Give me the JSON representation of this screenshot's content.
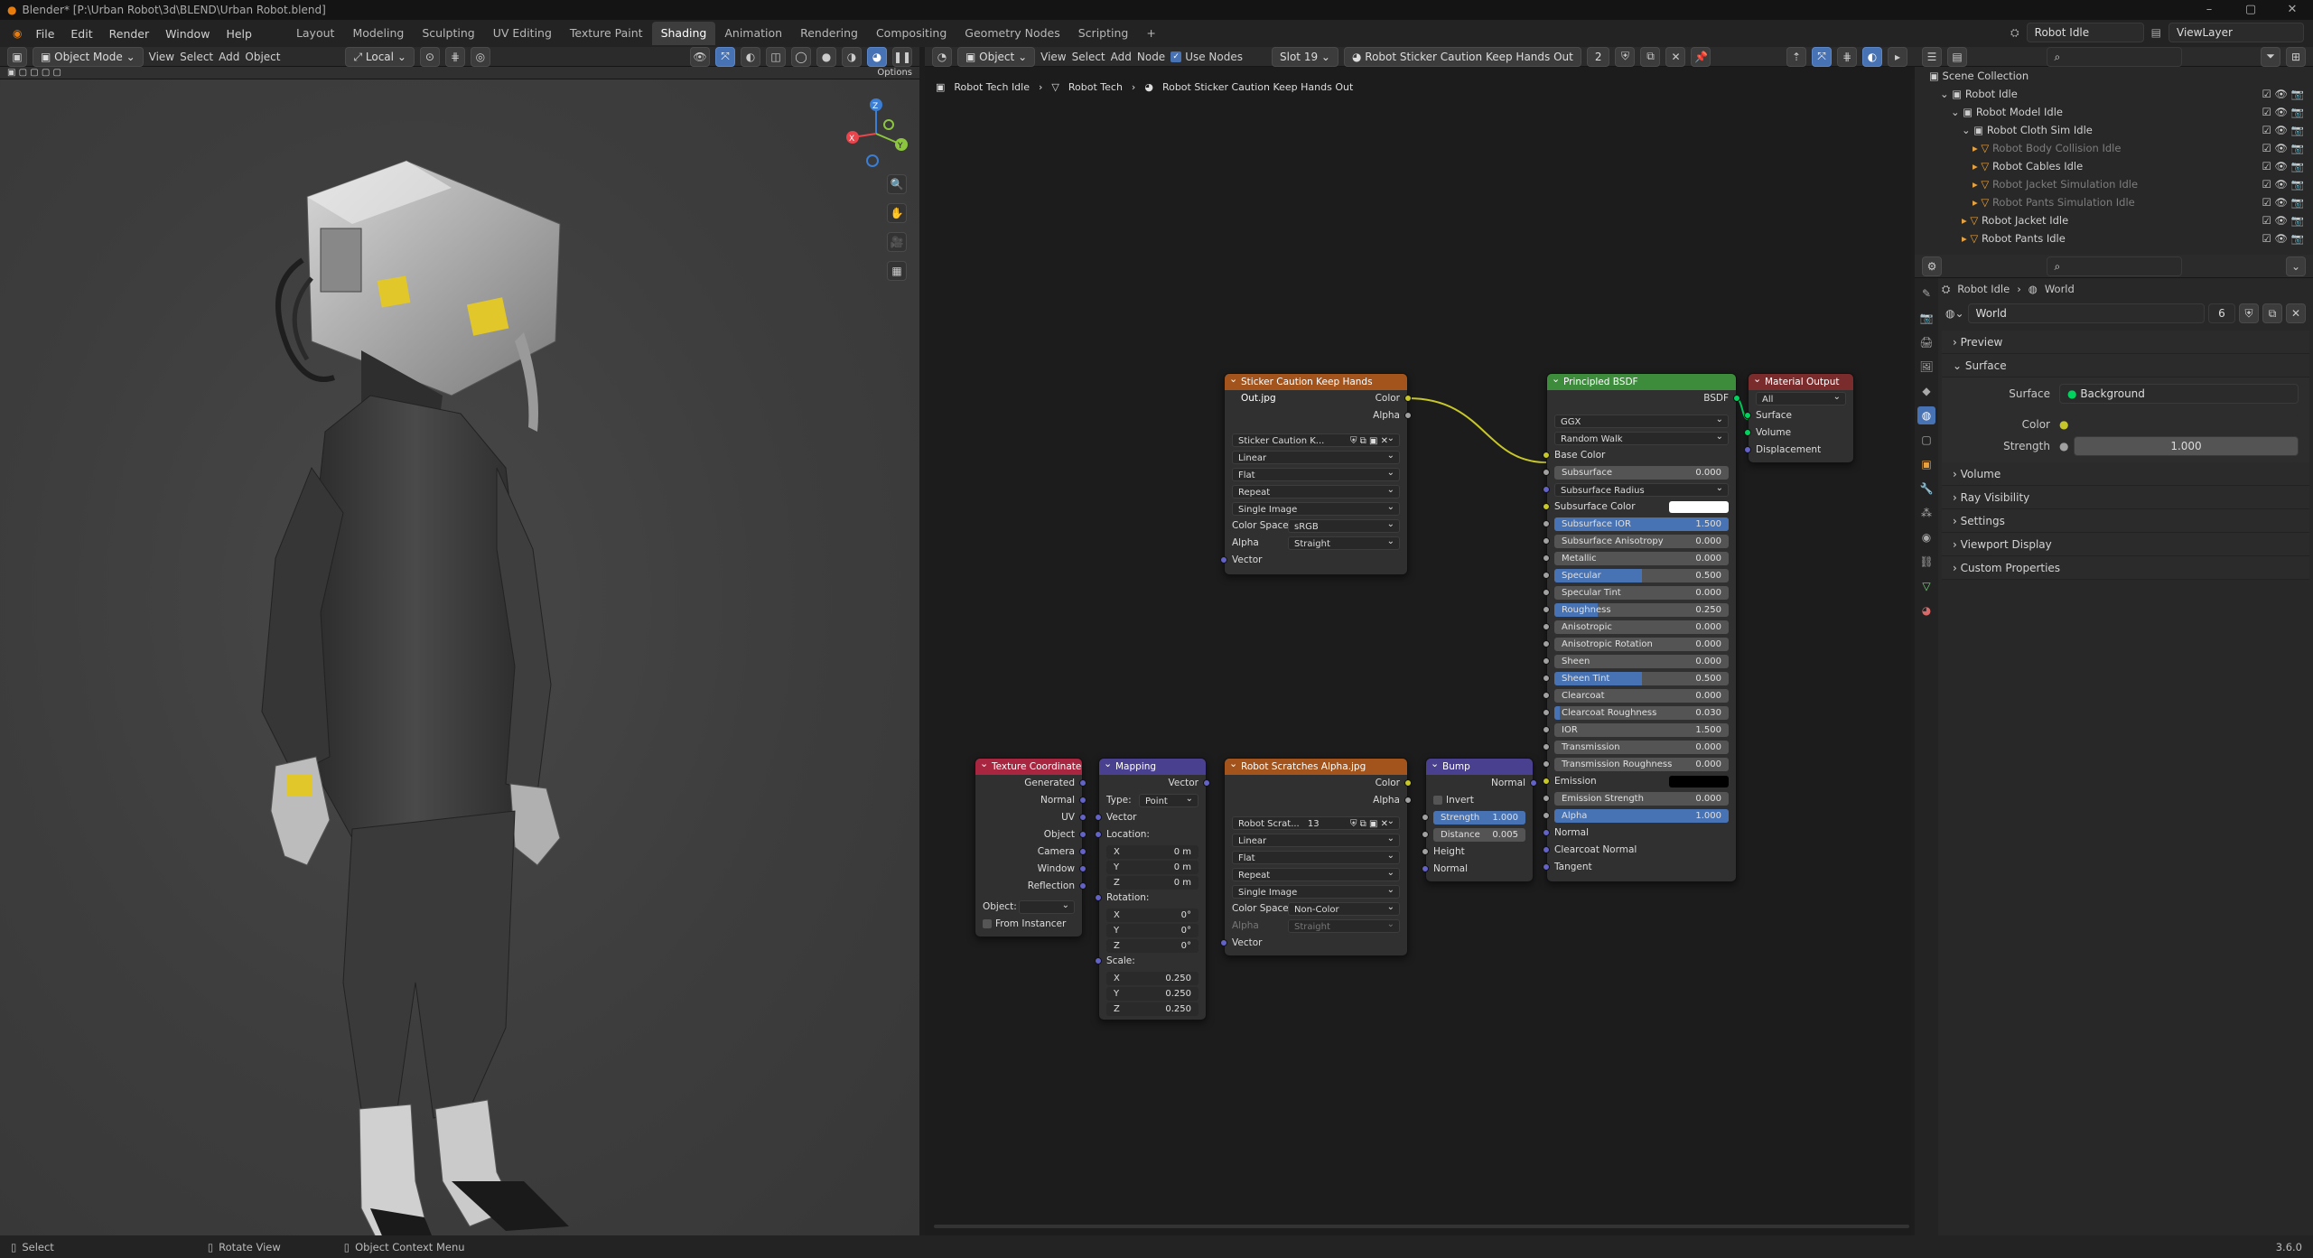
{
  "window": {
    "title": "Blender* [P:\\Urban Robot\\3d\\BLEND\\Urban Robot.blend]",
    "controls": [
      "–",
      "▢",
      "✕"
    ]
  },
  "menus": [
    "File",
    "Edit",
    "Render",
    "Window",
    "Help"
  ],
  "workspaces": [
    "Layout",
    "Modeling",
    "Sculpting",
    "UV Editing",
    "Texture Paint",
    "Shading",
    "Animation",
    "Rendering",
    "Compositing",
    "Geometry Nodes",
    "Scripting"
  ],
  "active_workspace": "Shading",
  "scene_name": "Robot Idle",
  "view_layer": "ViewLayer",
  "viewport": {
    "mode": "Object Mode",
    "menus": [
      "View",
      "Select",
      "Add",
      "Object"
    ],
    "transform_orientation": "Local",
    "options_label": "Options"
  },
  "node_editor": {
    "object_type": "Object",
    "menus": [
      "View",
      "Select",
      "Add",
      "Node"
    ],
    "use_nodes_label": "Use Nodes",
    "slot": "Slot 19",
    "material": "Robot Sticker Caution Keep Hands Out",
    "users": "2",
    "breadcrumb": [
      "Robot Tech Idle",
      "Robot Tech",
      "Robot Sticker Caution Keep Hands Out"
    ]
  },
  "nodes": {
    "sticker_image": {
      "title": "Sticker Caution Keep Hands Out.jpg",
      "outputs": [
        "Color",
        "Alpha"
      ],
      "image_name": "Sticker Caution K...",
      "interpolation": "Linear",
      "projection": "Flat",
      "extension": "Repeat",
      "source": "Single Image",
      "color_space_label": "Color Space",
      "color_space": "sRGB",
      "alpha_label": "Alpha",
      "alpha": "Straight",
      "input": "Vector"
    },
    "bsdf": {
      "title": "Principled BSDF",
      "output": "BSDF",
      "distribution": "GGX",
      "subsurface_method": "Random Walk",
      "base_color": "Base Color",
      "rows": [
        {
          "label": "Subsurface",
          "value": "0.000",
          "fill": 0
        },
        {
          "label": "Subsurface Radius",
          "value": "",
          "fill": 0,
          "dropdown": true
        },
        {
          "label": "Subsurface Color",
          "value": "",
          "fill": 0,
          "color": "#ffffff"
        },
        {
          "label": "Subsurface IOR",
          "value": "1.500",
          "fill": 1
        },
        {
          "label": "Subsurface Anisotropy",
          "value": "0.000",
          "fill": 0
        },
        {
          "label": "Metallic",
          "value": "0.000",
          "fill": 0
        },
        {
          "label": "Specular",
          "value": "0.500",
          "fill": 0.5
        },
        {
          "label": "Specular Tint",
          "value": "0.000",
          "fill": 0
        },
        {
          "label": "Roughness",
          "value": "0.250",
          "fill": 0.25
        },
        {
          "label": "Anisotropic",
          "value": "0.000",
          "fill": 0
        },
        {
          "label": "Anisotropic Rotation",
          "value": "0.000",
          "fill": 0
        },
        {
          "label": "Sheen",
          "value": "0.000",
          "fill": 0
        },
        {
          "label": "Sheen Tint",
          "value": "0.500",
          "fill": 0.5
        },
        {
          "label": "Clearcoat",
          "value": "0.000",
          "fill": 0
        },
        {
          "label": "Clearcoat Roughness",
          "value": "0.030",
          "fill": 0.03
        },
        {
          "label": "IOR",
          "value": "1.500",
          "fill": 0
        },
        {
          "label": "Transmission",
          "value": "0.000",
          "fill": 0
        },
        {
          "label": "Transmission Roughness",
          "value": "0.000",
          "fill": 0
        },
        {
          "label": "Emission",
          "value": "",
          "fill": 0,
          "color": "#000000"
        },
        {
          "label": "Emission Strength",
          "value": "0.000",
          "fill": 0
        },
        {
          "label": "Alpha",
          "value": "1.000",
          "fill": 1
        }
      ],
      "tail_inputs": [
        "Normal",
        "Clearcoat Normal",
        "Tangent"
      ]
    },
    "material_output": {
      "title": "Material Output",
      "target": "All",
      "inputs": [
        "Surface",
        "Volume",
        "Displacement"
      ]
    },
    "tex_coord": {
      "title": "Texture Coordinate",
      "outputs": [
        "Generated",
        "Normal",
        "UV",
        "Object",
        "Camera",
        "Window",
        "Reflection"
      ],
      "object_label": "Object:",
      "from_instancer": "From Instancer"
    },
    "mapping": {
      "title": "Mapping",
      "output": "Vector",
      "type_label": "Type:",
      "type": "Point",
      "vector": "Vector",
      "location_label": "Location:",
      "rotation_label": "Rotation:",
      "scale_label": "Scale:",
      "location": [
        {
          "axis": "X",
          "value": "0 m"
        },
        {
          "axis": "Y",
          "value": "0 m"
        },
        {
          "axis": "Z",
          "value": "0 m"
        }
      ],
      "rotation": [
        {
          "axis": "X",
          "value": "0°"
        },
        {
          "axis": "Y",
          "value": "0°"
        },
        {
          "axis": "Z",
          "value": "0°"
        }
      ],
      "scale": [
        {
          "axis": "X",
          "value": "0.250"
        },
        {
          "axis": "Y",
          "value": "0.250"
        },
        {
          "axis": "Z",
          "value": "0.250"
        }
      ]
    },
    "scratch_image": {
      "title": "Robot Scratches Alpha.jpg",
      "outputs": [
        "Color",
        "Alpha"
      ],
      "image_name": "Robot Scrat...",
      "users": "13",
      "interpolation": "Linear",
      "projection": "Flat",
      "extension": "Repeat",
      "source": "Single Image",
      "color_space_label": "Color Space",
      "color_space": "Non-Color",
      "alpha_label": "Alpha",
      "alpha": "Straight",
      "input": "Vector"
    },
    "bump": {
      "title": "Bump",
      "output": "Normal",
      "invert": "Invert",
      "strength_label": "Strength",
      "strength": "1.000",
      "distance_label": "Distance",
      "distance": "0.005",
      "inputs": [
        "Height",
        "Normal"
      ]
    }
  },
  "outliner": {
    "root": "Scene Collection",
    "items": [
      {
        "label": "Robot Idle",
        "depth": 1
      },
      {
        "label": "Robot Model Idle",
        "depth": 2
      },
      {
        "label": "Robot Cloth Sim Idle",
        "depth": 3
      },
      {
        "label": "Robot Body Collision Idle",
        "depth": 4,
        "dim": true
      },
      {
        "label": "Robot Cables Idle",
        "depth": 4
      },
      {
        "label": "Robot Jacket Simulation Idle",
        "depth": 4,
        "dim": true
      },
      {
        "label": "Robot Pants Simulation Idle",
        "depth": 4,
        "dim": true
      },
      {
        "label": "Robot Jacket Idle",
        "depth": 3
      },
      {
        "label": "Robot Pants Idle",
        "depth": 3
      }
    ]
  },
  "properties": {
    "breadcrumb": [
      "Robot Idle",
      "World"
    ],
    "world_name": "World",
    "world_users": "6",
    "sections": [
      "Preview",
      "Surface",
      "Volume",
      "Ray Visibility",
      "Settings",
      "Viewport Display",
      "Custom Properties"
    ],
    "surface_label": "Surface",
    "surface_value": "Background",
    "color_label": "Color",
    "strength_label": "Strength",
    "strength_value": "1.000"
  },
  "status": {
    "select": "Select",
    "rotate": "Rotate View",
    "context": "Object Context Menu",
    "version": "3.6.0"
  }
}
